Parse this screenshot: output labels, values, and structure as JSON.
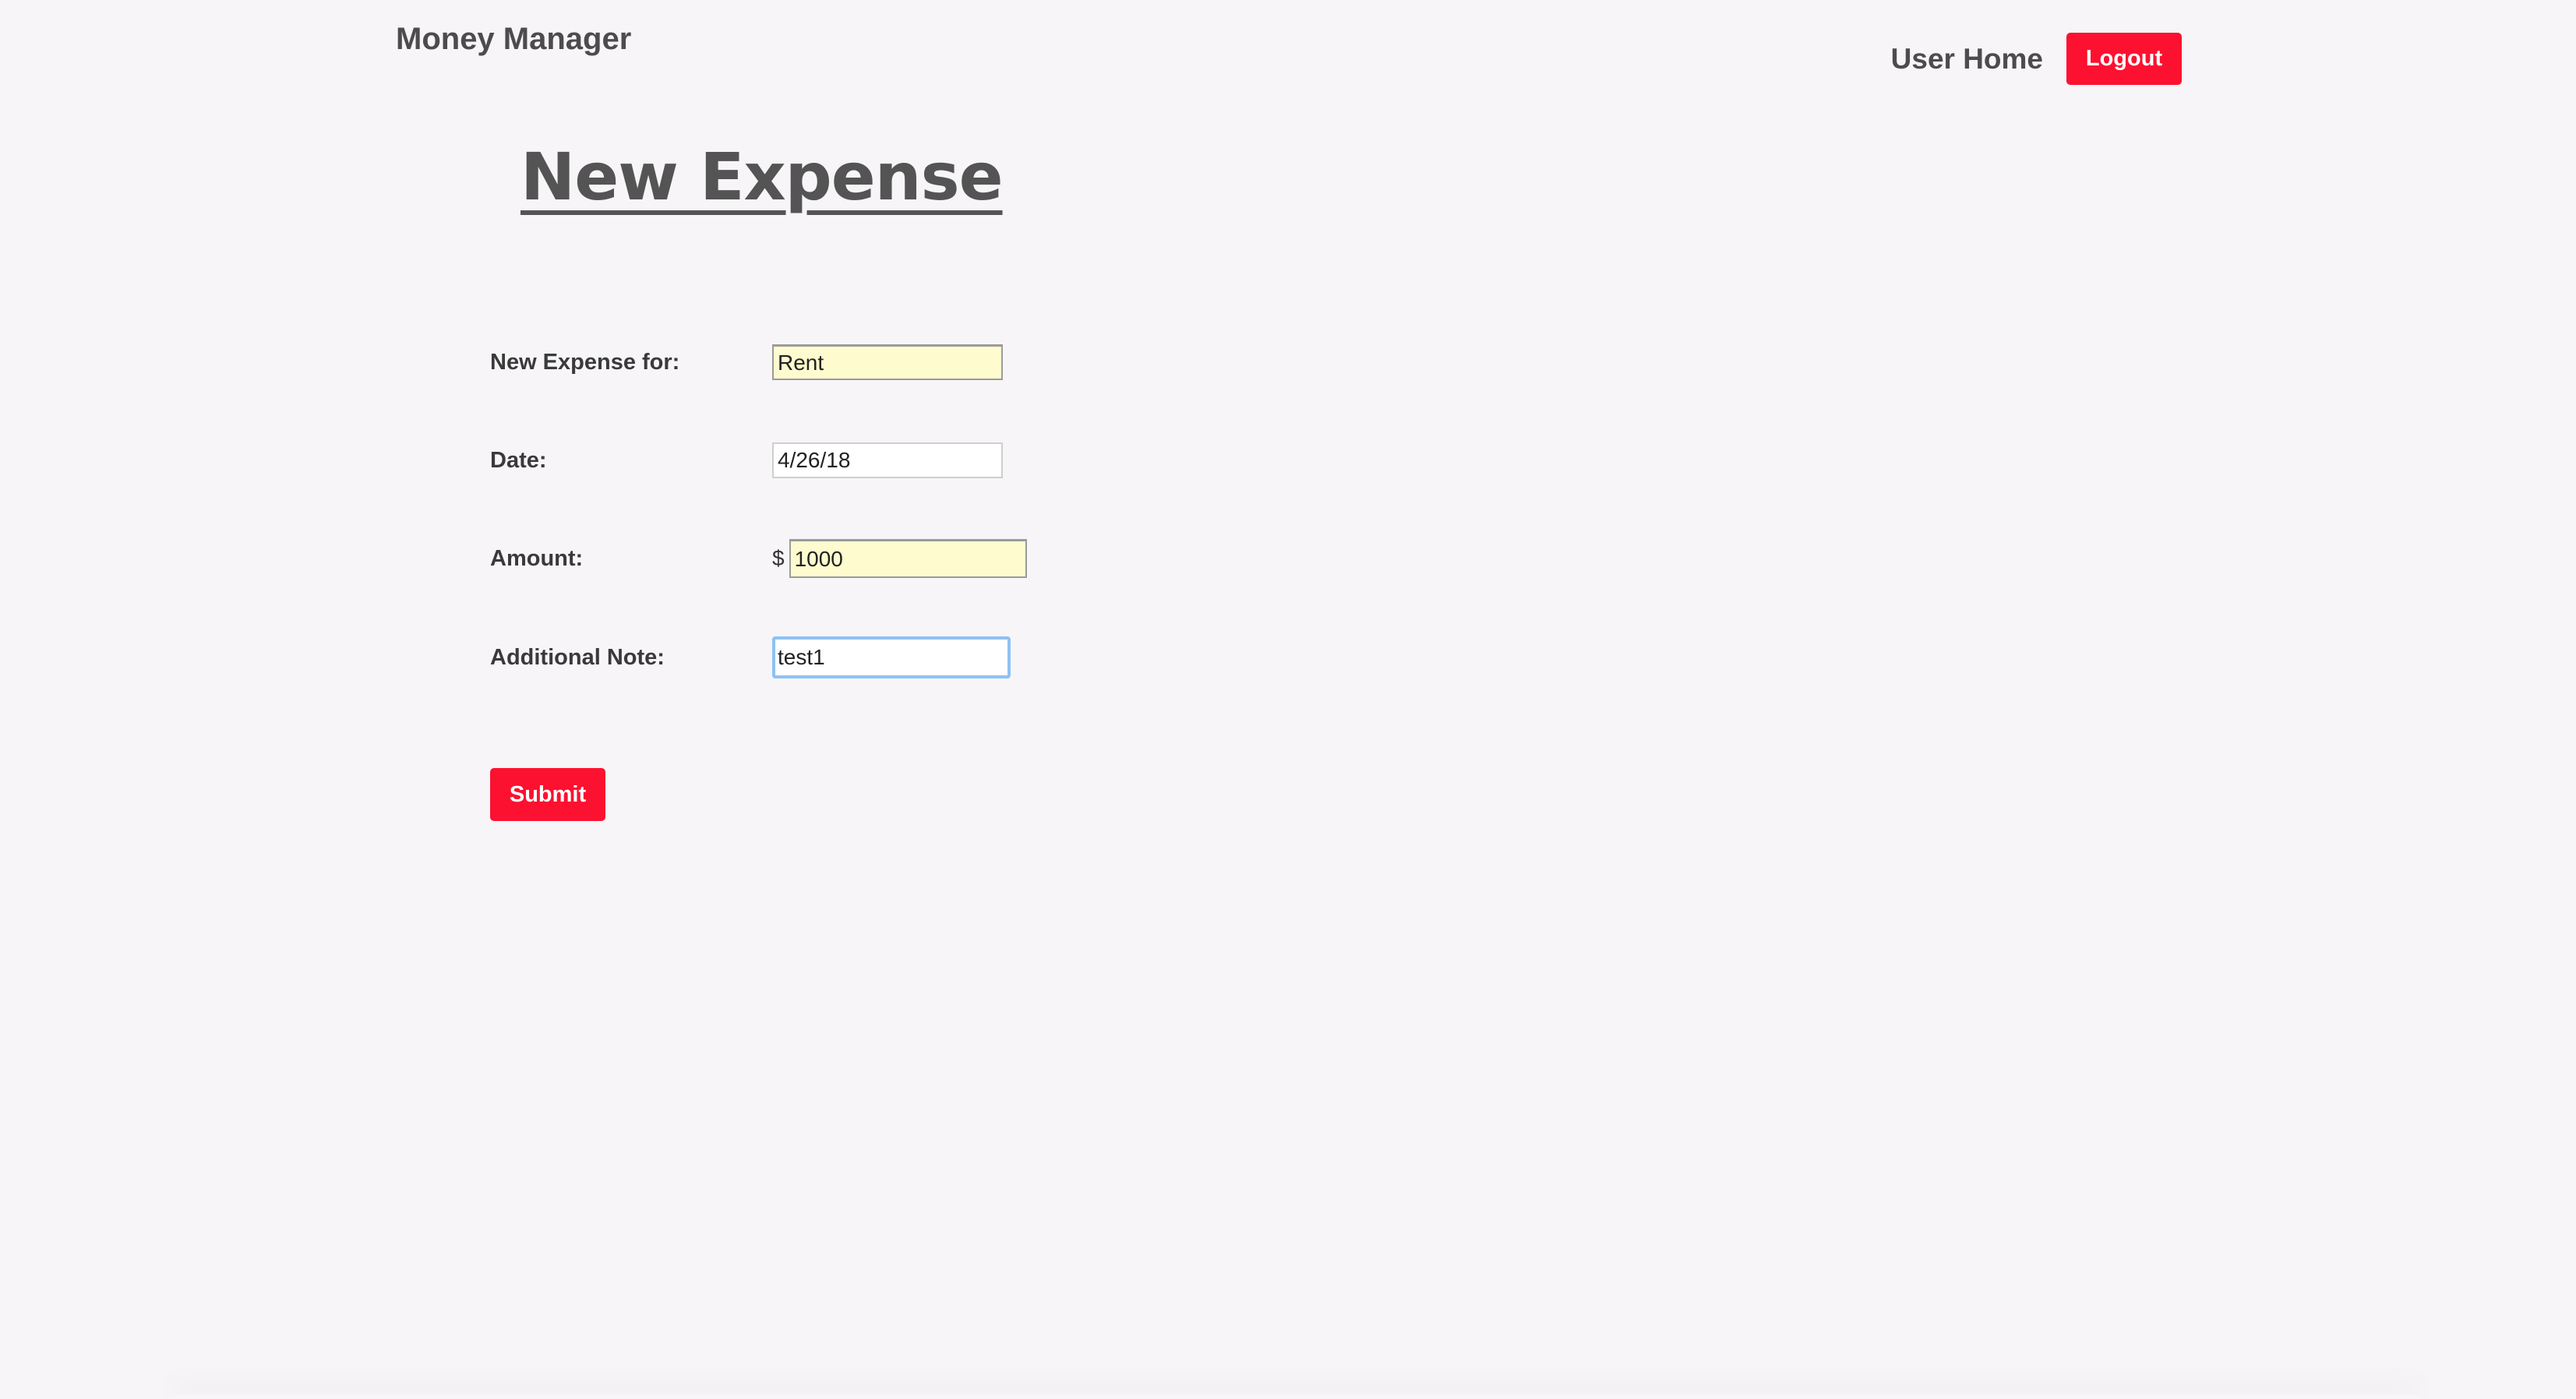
{
  "header": {
    "brand": "Money Manager",
    "nav_link": "User Home",
    "logout_label": "Logout"
  },
  "page": {
    "title": "New Expense"
  },
  "form": {
    "expense_for": {
      "label": "New Expense for:",
      "value": "Rent"
    },
    "date": {
      "label": "Date:",
      "value": "4/26/18"
    },
    "amount": {
      "label": "Amount:",
      "currency": "$",
      "value": "1000"
    },
    "note": {
      "label": "Additional Note:",
      "value": "test1"
    },
    "submit_label": "Submit"
  },
  "colors": {
    "accent": "#fc1130",
    "background": "#f7f5f8",
    "autofill": "#fefccf",
    "focus_ring": "#8ec1f2"
  }
}
